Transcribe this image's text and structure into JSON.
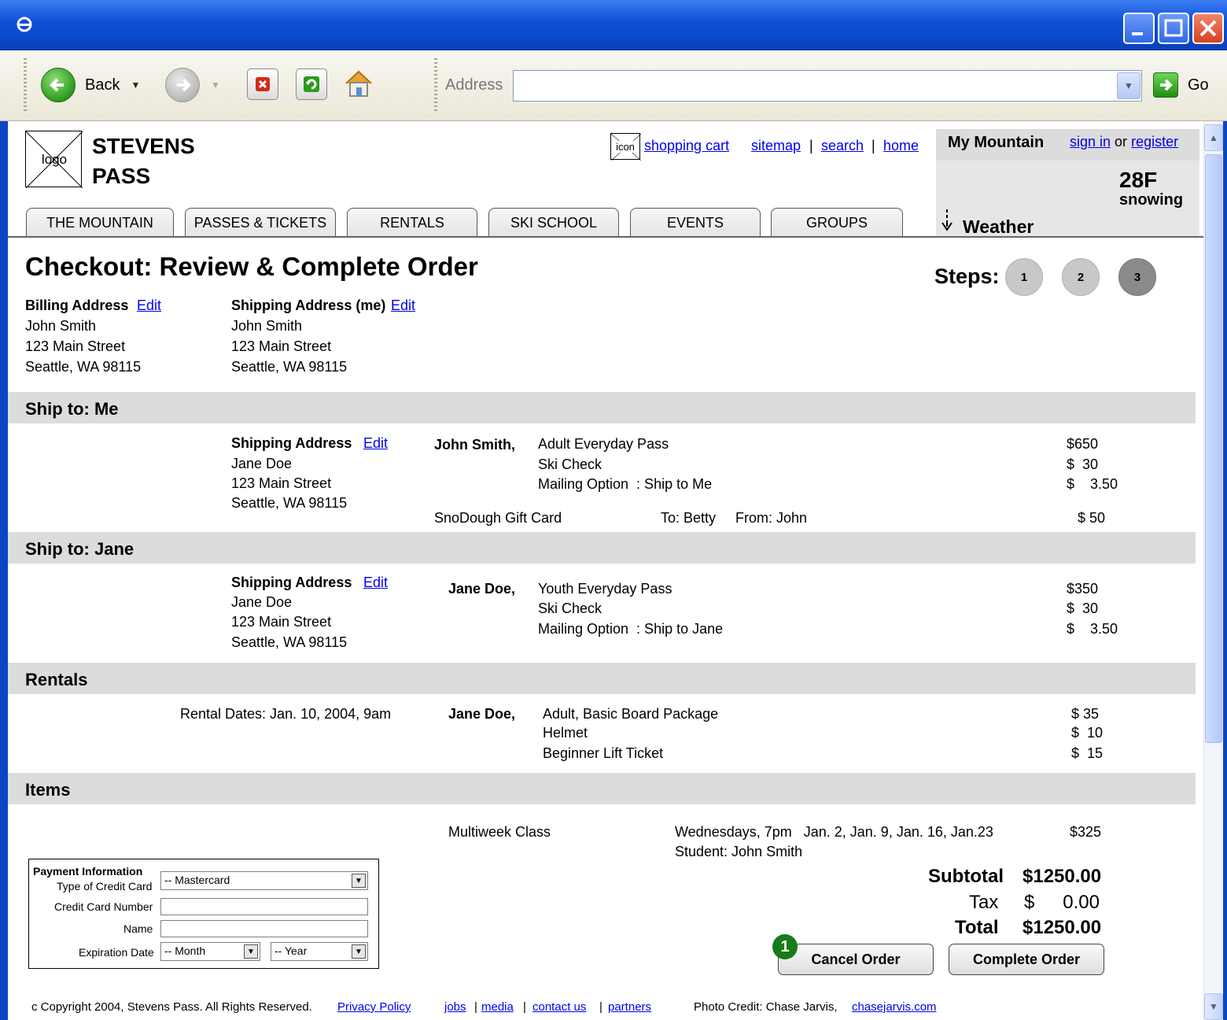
{
  "browser": {
    "back_label": "Back",
    "address_label": "Address",
    "address_value": "",
    "go_label": "Go"
  },
  "header": {
    "logo_placeholder": "logo",
    "brand_line1": "STEVENS",
    "brand_line2": "PASS",
    "cart_icon_placeholder": "icon",
    "cart_link": "shopping cart",
    "links": [
      "sitemap",
      "search",
      "home"
    ],
    "separator": "|"
  },
  "my_mountain": {
    "title": "My Mountain",
    "sign_in": "sign in",
    "or": "or",
    "register": "register",
    "temperature": "28F",
    "conditions": "snowing",
    "weather_label": "Weather"
  },
  "tabs": [
    "THE MOUNTAIN",
    "PASSES & TICKETS",
    "RENTALS",
    "SKI SCHOOL",
    "EVENTS",
    "GROUPS"
  ],
  "page": {
    "title": "Checkout: Review & Complete Order",
    "steps_label": "Steps:",
    "steps": [
      "1",
      "2",
      "3"
    ],
    "current_step": 3
  },
  "billing": {
    "label": "Billing Address",
    "edit": "Edit",
    "lines": [
      "John Smith",
      "123 Main Street",
      "Seattle, WA 98115"
    ]
  },
  "shipping_me": {
    "label": "Shipping Address (me)",
    "edit": "Edit",
    "lines": [
      "John Smith",
      "123 Main Street",
      "Seattle, WA 98115"
    ]
  },
  "ship_to_me": {
    "title": "Ship to: Me",
    "address_label": "Shipping Address",
    "edit": "Edit",
    "address_lines": [
      "Jane Doe",
      "123 Main Street",
      "Seattle, WA 98115"
    ],
    "person": "John Smith,",
    "items": [
      "Adult Everyday Pass",
      "Ski Check",
      "Mailing Option  : Ship to Me"
    ],
    "prices": [
      "$650",
      "$  30",
      "$    3.50"
    ],
    "gift_card": "SnoDough Gift Card",
    "gift_to": "To: Betty",
    "gift_from": "From: John",
    "gift_price": "$ 50"
  },
  "ship_to_jane": {
    "title": "Ship to: Jane",
    "address_label": "Shipping Address",
    "edit": "Edit",
    "address_lines": [
      "Jane Doe",
      "123 Main Street",
      "Seattle, WA 98115"
    ],
    "person": "Jane Doe,",
    "items": [
      "Youth Everyday Pass",
      "Ski Check",
      "Mailing Option  : Ship to Jane"
    ],
    "prices": [
      "$350",
      "$  30",
      "$    3.50"
    ]
  },
  "rentals": {
    "title": "Rentals",
    "dates": "Rental Dates: Jan. 10, 2004, 9am",
    "person": "Jane Doe,",
    "items": [
      "Adult, Basic Board Package",
      "Helmet",
      "Beginner Lift Ticket"
    ],
    "prices": [
      "$ 35",
      "$  10",
      "$  15"
    ]
  },
  "items": {
    "title": "Items",
    "name": "Multiweek Class",
    "schedule": "Wednesdays, 7pm   Jan. 2, Jan. 9, Jan. 16, Jan.23",
    "student": "Student: John Smith",
    "price": "$325"
  },
  "payment": {
    "title": "Payment Information",
    "card_type_label": "Type of Credit Card",
    "card_type_value": "-- Mastercard",
    "card_number_label": "Credit Card Number",
    "name_label": "Name",
    "expiration_label": "Expiration Date",
    "month_value": "-- Month",
    "year_value": "-- Year"
  },
  "totals": {
    "subtotal_label": "Subtotal",
    "subtotal_value": "$1250.00",
    "tax_label": "Tax",
    "tax_currency": "$",
    "tax_value": "0.00",
    "total_label": "Total",
    "total_value": "$1250.00"
  },
  "actions": {
    "badge": "1",
    "cancel": "Cancel Order",
    "complete": "Complete Order"
  },
  "footer": {
    "copyright": "c Copyright 2004, Stevens Pass. All Rights Reserved.",
    "privacy": "Privacy Policy",
    "links": [
      "jobs",
      "media",
      "contact us",
      "partners"
    ],
    "separator": "|",
    "photo_credit": "Photo Credit: Chase Jarvis,",
    "photo_link": "chasejarvis.com"
  },
  "colors": {
    "titlebar": "#0f4fd6",
    "section_bar": "#dcdcdc",
    "link": "#0000ee",
    "badge": "#187b1a"
  }
}
